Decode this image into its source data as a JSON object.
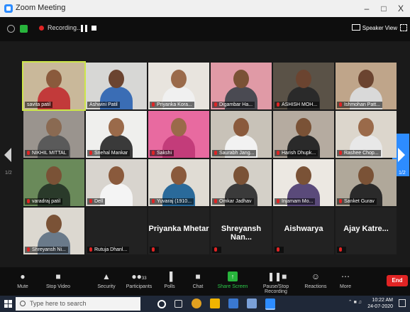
{
  "window": {
    "title": "Zoom Meeting",
    "minimize": "–",
    "maximize": "□",
    "close": "X"
  },
  "topbar": {
    "recording_label": "Recording...",
    "view_label": "Speaker View"
  },
  "pagination": {
    "left": "1/2",
    "right": "1/2"
  },
  "participants": [
    {
      "name": "savita patil"
    },
    {
      "name": "Ashwini Patil"
    },
    {
      "name": "Priyanka Kora..."
    },
    {
      "name": "Digambar Ha..."
    },
    {
      "name": "ASHISH MOH..."
    },
    {
      "name": "Ishmohan Patt..."
    },
    {
      "name": "NIKHIL MITTAL"
    },
    {
      "name": "Snehal Mankar"
    },
    {
      "name": "Sakshi"
    },
    {
      "name": "Saurabh Jang..."
    },
    {
      "name": "Harish Dhupk..."
    },
    {
      "name": "Rashee Chop..."
    },
    {
      "name": "varadraj patil"
    },
    {
      "name": "Dell"
    },
    {
      "name": "Yuvaraj (1910..."
    },
    {
      "name": "Omkar Jadhav"
    },
    {
      "name": "Injamam Mo..."
    },
    {
      "name": "Sanket Gurav"
    },
    {
      "name": "Shreyansh Ni..."
    },
    {
      "name": "Rutuja Dhanl..."
    }
  ],
  "name_tiles": [
    {
      "name": "Priyanka Mhetar"
    },
    {
      "name": "Shreyansh Nan..."
    },
    {
      "name": "Aishwarya"
    },
    {
      "name": "Ajay Katre..."
    }
  ],
  "toolbar": {
    "mute": "Mute",
    "stop_video": "Stop Video",
    "security": "Security",
    "participants": "Participants",
    "participants_count": "33",
    "polls": "Polls",
    "chat": "Chat",
    "share_screen": "Share Screen",
    "pause_recording": "Pause/Stop Recording",
    "reactions": "Reactions",
    "more": "More",
    "end": "End"
  },
  "taskbar": {
    "search_placeholder": "Type here to search",
    "time": "10:22 AM",
    "date": "24-07-2020"
  },
  "colors": {
    "accent": "#2d8cff",
    "end": "#e02424",
    "share": "#28b43c",
    "active_speaker": "#cde64a"
  }
}
